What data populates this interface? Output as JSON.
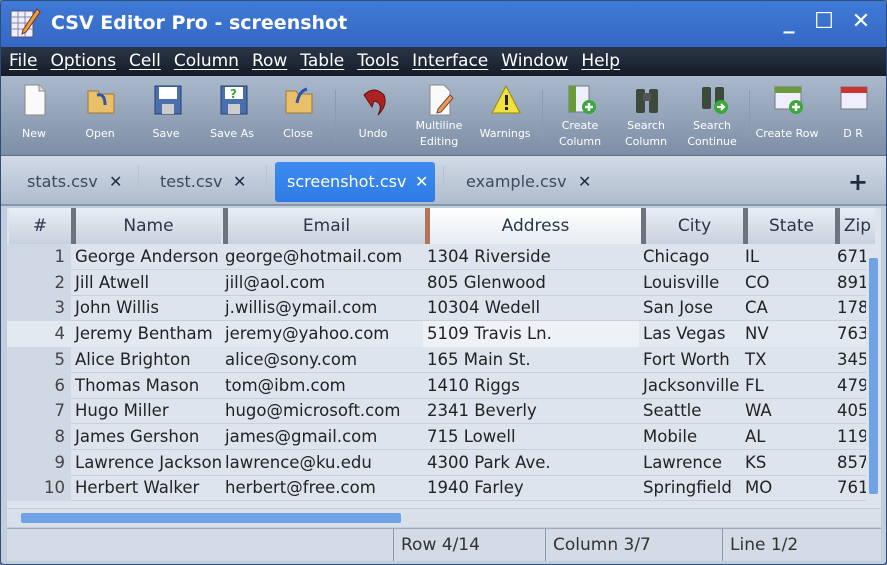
{
  "window": {
    "title": "CSV Editor Pro - screenshot",
    "minimize": "_",
    "maximize": "☐",
    "close": "✕"
  },
  "menu": [
    "File",
    "Options",
    "Cell",
    "Column",
    "Row",
    "Table",
    "Tools",
    "Interface",
    "Window",
    "Help"
  ],
  "toolbar": [
    {
      "label": "New",
      "icon": "new-file-icon"
    },
    {
      "label": "Open",
      "icon": "open-folder-icon"
    },
    {
      "label": "Save",
      "icon": "floppy-disk-icon"
    },
    {
      "label": "Save As",
      "icon": "save-as-icon"
    },
    {
      "label": "Close",
      "icon": "close-folder-icon"
    },
    {
      "label": "Undo",
      "icon": "undo-icon"
    },
    {
      "label": "Multiline Editing",
      "icon": "multiline-edit-icon"
    },
    {
      "label": "Warnings",
      "icon": "warning-icon"
    },
    {
      "label": "Create Column",
      "icon": "create-column-icon"
    },
    {
      "label": "Search Column",
      "icon": "binoculars-icon"
    },
    {
      "label": "Search Continue",
      "icon": "binoculars-continue-icon"
    },
    {
      "label": "Create Row",
      "icon": "create-row-icon"
    },
    {
      "label": "D R",
      "icon": "delete-row-icon"
    }
  ],
  "tabs": [
    {
      "label": "stats.csv",
      "close": "✕"
    },
    {
      "label": "test.csv",
      "close": "✕"
    },
    {
      "label": "screenshot.csv",
      "close": "✕",
      "active": true
    },
    {
      "label": "example.csv",
      "close": "✕"
    }
  ],
  "add_tab": "+",
  "columns": [
    "#",
    "Name",
    "Email",
    "Address",
    "City",
    "State",
    "Zip"
  ],
  "rows": [
    [
      "1",
      "George Anderson",
      "george@hotmail.com",
      "1304 Riverside",
      "Chicago",
      "IL",
      "671"
    ],
    [
      "2",
      "Jill Atwell",
      "jill@aol.com",
      "805 Glenwood",
      "Louisville",
      "CO",
      "891"
    ],
    [
      "3",
      "John Willis",
      "j.willis@ymail.com",
      "10304 Wedell",
      "San Jose",
      "CA",
      "178"
    ],
    [
      "4",
      "Jeremy Bentham",
      "jeremy@yahoo.com",
      "5109 Travis Ln.",
      "Las Vegas",
      "NV",
      "763"
    ],
    [
      "5",
      "Alice Brighton",
      "alice@sony.com",
      "165 Main St.",
      "Fort Worth",
      "TX",
      "345"
    ],
    [
      "6",
      "Thomas Mason",
      "tom@ibm.com",
      "1410 Riggs",
      "Jacksonville",
      "FL",
      "479"
    ],
    [
      "7",
      "Hugo Miller",
      "hugo@microsoft.com",
      "2341 Beverly",
      "Seattle",
      "WA",
      "405"
    ],
    [
      "8",
      "James Gershon",
      "james@gmail.com",
      "715 Lowell",
      "Mobile",
      "AL",
      "119"
    ],
    [
      "9",
      "Lawrence Jackson",
      "lawrence@ku.edu",
      "4300 Park Ave.",
      "Lawrence",
      "KS",
      "857"
    ],
    [
      "10",
      "Herbert Walker",
      "herbert@free.com",
      "1940 Farley",
      "Springfield",
      "MO",
      "761"
    ]
  ],
  "status": {
    "row": "Row 4/14",
    "column": "Column 3/7",
    "line": "Line 1/2"
  }
}
